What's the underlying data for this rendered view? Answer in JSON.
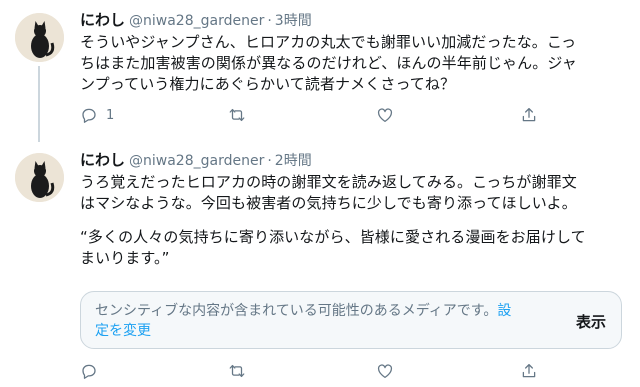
{
  "tweets": [
    {
      "name": "にわし",
      "handle": "@niwa28_gardener",
      "separator": "·",
      "time": "3時間",
      "lines": [
        "そういやジャンプさん、ヒロアカの丸太でも謝罪いい加減だったな。こっ",
        "ちはまた加害被害の関係が異なるのだけれど、ほんの半年前じゃん。ジャ",
        "ンプっていう権力にあぐらかいて読者ナメくさってね？"
      ],
      "reply_count": "1",
      "icons": [
        "reply-icon",
        "retweet-icon",
        "like-icon",
        "share-icon"
      ]
    },
    {
      "name": "にわし",
      "handle": "@niwa28_gardener",
      "separator": "·",
      "time": "2時間",
      "lines": [
        "うろ覚えだったヒロアカの時の謝罪文を読み返してみる。こっちが謝罪文",
        "はマシなような。今回も被害者の気持ちに少しでも寄り添ってほしいよ。"
      ],
      "quote_lines": [
        "“多くの人々の気持ちに寄り添いながら、皆様に愛される漫画をお届けして",
        "まいります。”"
      ],
      "sensitive": {
        "message": "センシティブな内容が含まれている可能性のあるメディアです。",
        "settings_link": "設定を変更",
        "show_label": "表示"
      },
      "icons": [
        "reply-icon",
        "retweet-icon",
        "like-icon",
        "share-icon"
      ]
    }
  ],
  "colors": {
    "text": "#14171a",
    "secondary": "#657786",
    "link": "#1da1f2",
    "border": "#ccd6dd",
    "thread_line": "#ccd6dd"
  }
}
